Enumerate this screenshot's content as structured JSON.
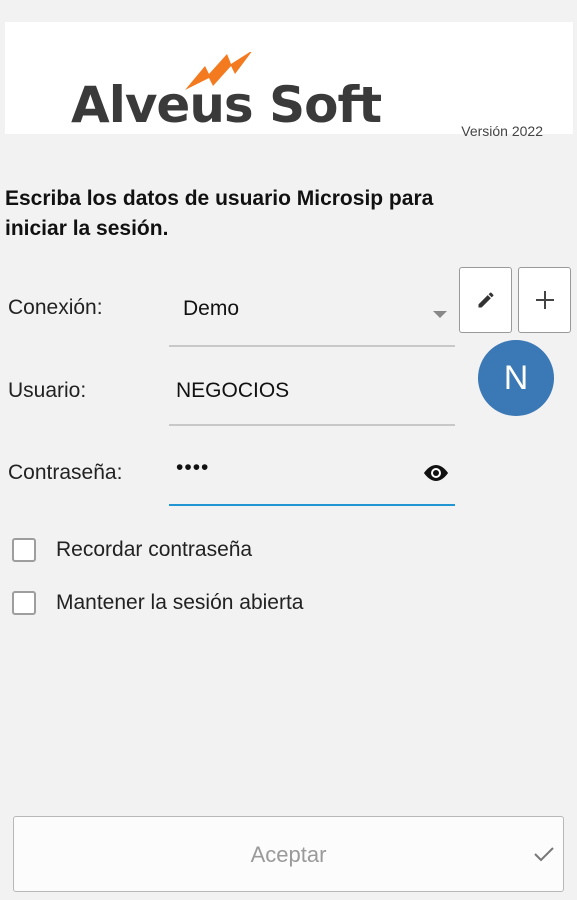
{
  "header": {
    "brand": "Alveus Soft",
    "version": "Versión 2022",
    "accent_color": "#f47a20"
  },
  "instructions": "Escriba los datos de usuario Microsip para iniciar la sesión.",
  "form": {
    "connection": {
      "label": "Conexión:",
      "value": "Demo"
    },
    "user": {
      "label": "Usuario:",
      "value": "NEGOCIOS"
    },
    "password": {
      "label": "Contraseña:",
      "value": "••••"
    }
  },
  "buttons": {
    "edit_icon": "pencil-icon",
    "add_icon": "plus-icon",
    "avatar_initial": "N",
    "avatar_color": "#3a78b6",
    "accept": "Aceptar"
  },
  "options": {
    "remember_password": "Recordar contraseña",
    "keep_session": "Mantener la sesión abierta"
  }
}
